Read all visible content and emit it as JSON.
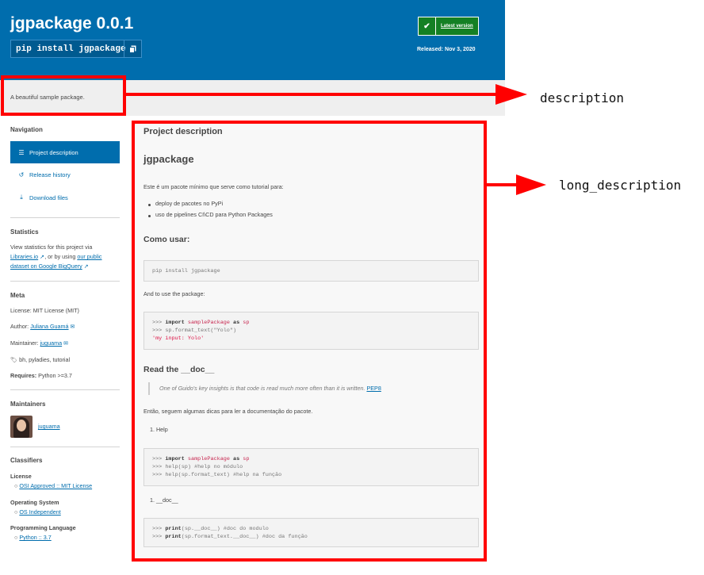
{
  "header": {
    "title": "jgpackage 0.0.1",
    "pip_command": "pip install jgpackage",
    "latest_label": "Latest version",
    "released": "Released: Nov 3, 2020",
    "copy_icon": "copy-icon",
    "check_icon": "check-icon"
  },
  "description": {
    "text": "A beautiful sample package.",
    "annotation": "description"
  },
  "long_description_annotation": "long_description",
  "sidebar": {
    "navigation": {
      "heading": "Navigation",
      "items": [
        {
          "label": "Project description",
          "icon": "align-left-icon",
          "active": true
        },
        {
          "label": "Release history",
          "icon": "history-icon",
          "active": false
        },
        {
          "label": "Download files",
          "icon": "download-icon",
          "active": false
        }
      ]
    },
    "statistics": {
      "heading": "Statistics",
      "text1": "View statistics for this project via",
      "libraries_link": "Libraries.io",
      "text2": ", or by using",
      "bigquery_link_1": "our public",
      "bigquery_link_2": "dataset on Google BigQuery"
    },
    "meta": {
      "heading": "Meta",
      "license": "License: MIT License (MIT)",
      "author_label": "Author:",
      "author": "Juliana Guamá",
      "maintainer_label": "Maintainer:",
      "maintainer": "juguama",
      "tags": "bh, pyladies, tutorial",
      "requires_label": "Requires:",
      "requires": "Python >=3.7"
    },
    "maintainers": {
      "heading": "Maintainers",
      "user": "juguama"
    },
    "classifiers": {
      "heading": "Classifiers",
      "license_heading": "License",
      "license_item": "OSI Approved :: MIT License",
      "os_heading": "Operating System",
      "os_item": "OS Independent",
      "lang_heading": "Programming Language",
      "lang_item": "Python :: 3.7"
    }
  },
  "main": {
    "title": "Project description",
    "h2": "jgpackage",
    "intro": "Este é um pacote mínimo que serve como tutorial para:",
    "bullets": [
      "deploy de pacotes no PyPi",
      "uso de pipelines CI\\CD para Python Packages"
    ],
    "como_usar": "Como usar:",
    "code1": "pip install jgpackage",
    "and_use": "And to use the package:",
    "code2": {
      "l1_prompt": ">>> ",
      "l1_kw": "import",
      "l1_mod": "samplePackage",
      "l1_as": "as",
      "l1_alias": "sp",
      "l2": ">>> sp.format_text(\"Yolo\")",
      "l3": "'my input: Yolo'"
    },
    "read_doc": "Read the __doc__",
    "quote": "One of Guido's key insights is that code is read much more often than it is written.",
    "pep_link": "PEP8",
    "entao": "Então, seguem algumas dicas para ler a documentação do pacote.",
    "help_item": "1. Help",
    "code3": {
      "l1_prompt": ">>> ",
      "l1_kw": "import",
      "l1_mod": "samplePackage",
      "l1_as": "as",
      "l1_alias": "sp",
      "l2": ">>> help(sp) #help no módulo",
      "l3": ">>> help(sp.format_text) #help na função"
    },
    "doc_item": "1. __doc__",
    "code4": {
      "l1_prompt": ">>> ",
      "l1_kw": "print",
      "l1_rest": "(sp.__doc__) #doc do modulo",
      "l2_prompt": ">>> ",
      "l2_kw": "print",
      "l2_rest": "(sp.format_text.__doc__) #doc da função"
    }
  },
  "colors": {
    "brand": "#006dad",
    "accent_green": "#148024",
    "annotation_red": "#ff0000"
  }
}
